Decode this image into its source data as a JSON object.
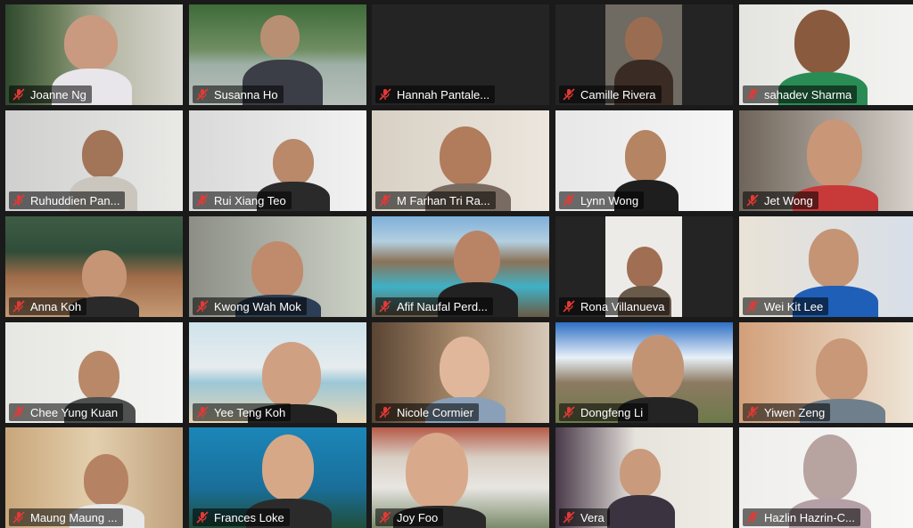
{
  "app": {
    "title": "Zoom Gallery View"
  },
  "colors": {
    "muted_icon": "#e53935",
    "tile_bg": "#2b2b2b"
  },
  "participants": [
    {
      "name": "Joanne Ng",
      "muted": true
    },
    {
      "name": "Susanna Ho",
      "muted": true
    },
    {
      "name": "Hannah Pantale...",
      "muted": true
    },
    {
      "name": "Camille Rivera",
      "muted": true
    },
    {
      "name": "sahadev Sharma",
      "muted": true
    },
    {
      "name": "Ruhuddien Pan...",
      "muted": true
    },
    {
      "name": "Rui Xiang Teo",
      "muted": true
    },
    {
      "name": "M Farhan Tri Ra...",
      "muted": true
    },
    {
      "name": "Lynn Wong",
      "muted": true
    },
    {
      "name": "Jet Wong",
      "muted": true
    },
    {
      "name": "Anna Koh",
      "muted": true
    },
    {
      "name": "Kwong Wah Mok",
      "muted": true
    },
    {
      "name": "Afif Naufal Perd...",
      "muted": true
    },
    {
      "name": "Rona Villanueva",
      "muted": true
    },
    {
      "name": "Wei Kit Lee",
      "muted": true
    },
    {
      "name": "Chee Yung Kuan",
      "muted": true
    },
    {
      "name": "Yee Teng Koh",
      "muted": true
    },
    {
      "name": "Nicole Cormier",
      "muted": true
    },
    {
      "name": "Dongfeng Li",
      "muted": true
    },
    {
      "name": "Yiwen Zeng",
      "muted": true
    },
    {
      "name": "Maung Maung ...",
      "muted": true
    },
    {
      "name": "Frances Loke",
      "muted": true
    },
    {
      "name": "Joy Foo",
      "muted": true
    },
    {
      "name": "Vera",
      "muted": true
    },
    {
      "name": "Hazlin Hazrin-C...",
      "muted": true
    }
  ]
}
